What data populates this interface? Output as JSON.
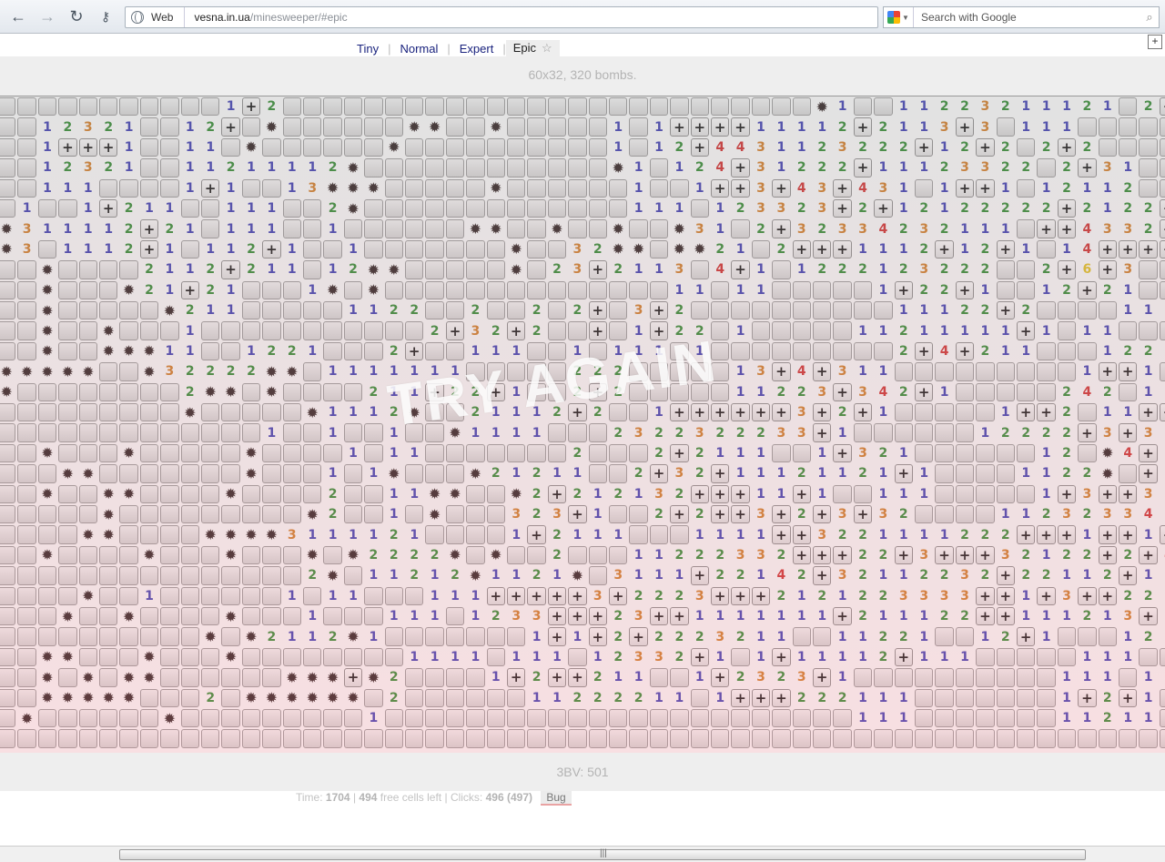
{
  "browser": {
    "url_host": "vesna.in.ua",
    "url_path": "/minesweeper/#epic",
    "security_label": "Web",
    "search_placeholder": "Search with Google"
  },
  "nav": {
    "items": [
      "Tiny",
      "Normal",
      "Expert",
      "Epic"
    ],
    "active": "Epic",
    "star": "☆",
    "corner_button": "+"
  },
  "board_info": "60x32, 320 bombs.",
  "overlay_text": "TRY AGAIN",
  "footer": {
    "bbbv": "3BV: 501",
    "time_label": "Time:",
    "time": "1704",
    "free_cells": "494",
    "free_cells_label": "free cells left",
    "clicks_label": "Clicks:",
    "clicks": "496",
    "clicks_total": "(497)",
    "bug_button": "Bug"
  },
  "colors": {
    "n1": "#3a3ab4",
    "n2": "#2e8b2e",
    "n3": "#d57c22",
    "n4": "#d42a2a",
    "link": "#1a237e"
  },
  "board": {
    "rows": [
      "###########1+2##########################*1##11223211121#2+2###",
      "##12321##12+#*######**##*#####1#1++++11112+2113+3#111#########",
      "##1+++1##11#*######*##########1#12+4431123222+12+2#2+2########",
      "##12321##11211112*############*1#124+31222+11123322#2+31#######",
      "##111####1+1##13***#####*######1##1++3+43+431#1++1#12112######",
      "#1##1+211##111##2*#############111#123323+2+12122222+2122+#####",
      "*311112+21#111##1######**##*##*##*31#2+32334232111#++4332+####",
      "*3#1112+1#112+1##1#######*##32**#**21#2+++1112+12+1#14+++++###",
      "##*####2112+211#12**#####*#23+2113#4+1#1222123222##2+6+3######",
      "##*###*21+21###1*#*##############11#11#####1+22+1##12+21######",
      "##*#####*211#####1122##2##2#2+#3+2##########11122+2####111#####",
      "##*##*###1###########2+32+2##+#1+22#1#####11211111+1#11########",
      "##*##***11##1221###2+##111##1#111#1#########2+4+211###1221#1#11",
      "*****##*32222**#1111111#####222#####13+4+311#########1++1#123+#",
      "*########2**#*####211+22+1##2+2#####11223+342+1#####242#12++2##",
      "#########*#####*1112*##21112+2##1++++++3+2+1#####1++2#11++43+##",
      "#############1##1##1##*1111###2322322233+1######12222+3+32+1###",
      "##*###*#####*####1#11#######2###2+2111##1+321######12#*4+1#####",
      "###**#######*###1#1*###*21211##2+32+11121121+1####1122*#+31####",
      "##*##**####*####2##11**##*2+212132+++11+1##111#####1+3++33+2###",
      "#####*#########*2##1#*###323+1##2+2++3+2+3+32####112323343+2###",
      "####**####****3111121####1+2111###1111++3221111222+++1++1+++2##",
      "##*####*###*###*#*2222*#*##2###11222332+++22+3+++32122+2+4+2###",
      "###############2*#11212*1121*#3111+22142+32112232+22112+12122+#",
      "####*##1######1#11###111+++++3+2223+++2121223333++1+3++2211#223",
      "###*##*####*###1###111#1233+++23++1111111+211122++111213+21+13#",
      "##########*#*2112*1#######1+1+2+2223211##11221##12+1###1211##12",
      "##**###*###*########1111#111#12332+1#1+11112+111#####111#######",
      "##*#*#**######***+*2####1+2++211##1+2323+1##########111#1111#11",
      "##*****###2#******#2######11222211#1+++222111#######1+2+1#####1",
      "#*######*#########1#######################111#######11211##11##",
      "################################################################"
    ]
  }
}
